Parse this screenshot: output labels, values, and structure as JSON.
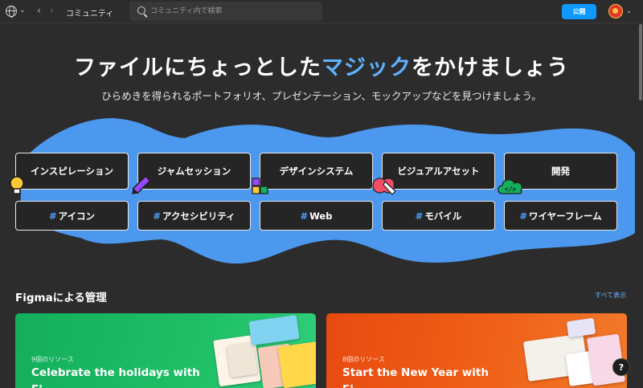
{
  "topbar": {
    "globe_icon": "globe-icon",
    "breadcrumb": "コミュニティ",
    "search_placeholder": "コミュニティ内で検索",
    "publish_label": "公開",
    "chevron": "⌄",
    "back": "‹",
    "forward": "›"
  },
  "hero": {
    "title_before": "ファイルにちょっとした",
    "title_highlight": "マジック",
    "title_after": "をかけましょう",
    "subtitle": "ひらめきを得られるポートフォリオ、プレゼンテーション、モックアップなどを見つけましょう。",
    "highlight_color": "#5fb2ff",
    "blob_color": "#4c98ee"
  },
  "categories": [
    {
      "label": "インスピレーション"
    },
    {
      "label": "ジャムセッション"
    },
    {
      "label": "デザインシステム"
    },
    {
      "label": "ビジュアルアセット"
    },
    {
      "label": "開発"
    }
  ],
  "tags": [
    {
      "hash": "#",
      "label": "アイコン"
    },
    {
      "hash": "#",
      "label": "アクセシビリティ"
    },
    {
      "hash": "#",
      "label": "Web"
    },
    {
      "hash": "#",
      "label": "モバイル"
    },
    {
      "hash": "#",
      "label": "ワイヤーフレーム"
    }
  ],
  "section": {
    "title": "Figmaによる管理",
    "see_all": "すべて表示"
  },
  "cards": [
    {
      "count": "9個のリソース",
      "title": "Celebrate the holidays with",
      "title_line2": "Fi",
      "color": "#14ae5c"
    },
    {
      "count": "8個のリソース",
      "title": "Start the New Year with",
      "title_line2": "Fi",
      "color": "#e84a10"
    }
  ],
  "help_label": "?"
}
